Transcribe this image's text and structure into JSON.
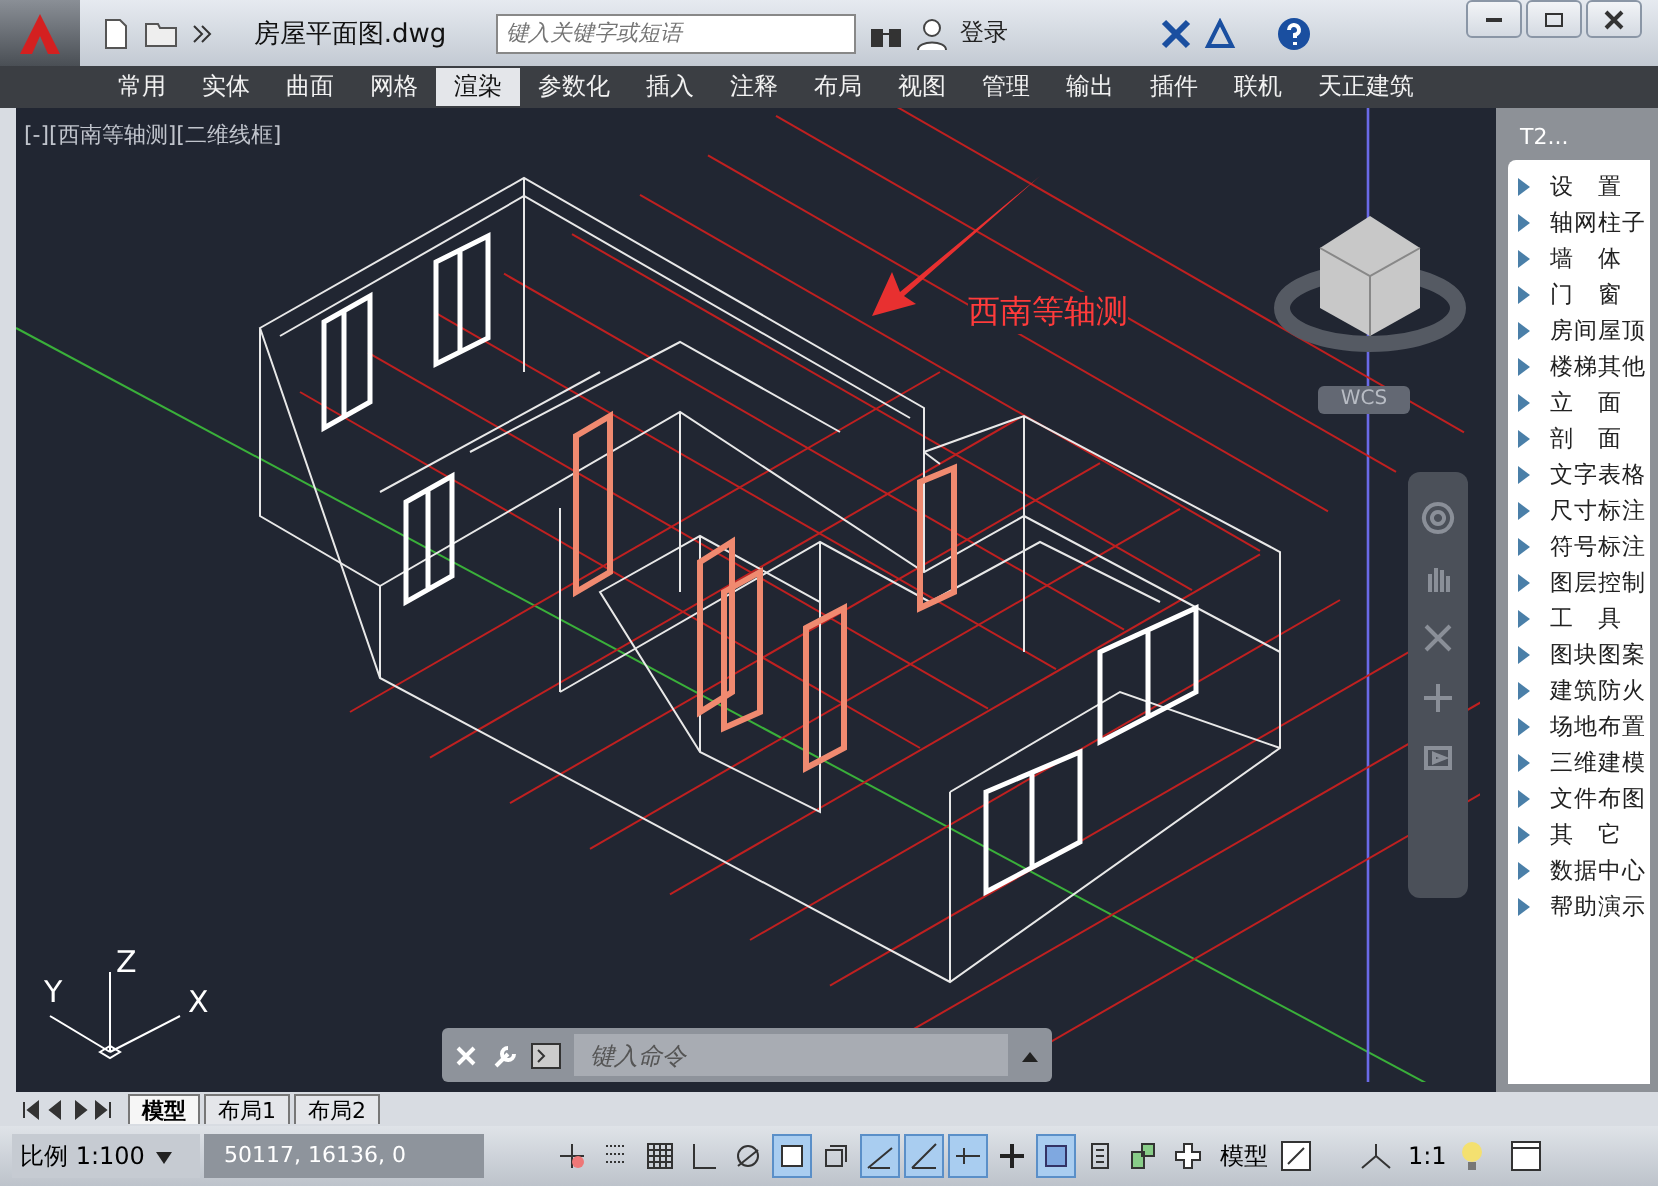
{
  "title_bar": {
    "document_title": "房屋平面图.dwg",
    "search": {
      "placeholder": "键入关键字或短语"
    },
    "login": "登录"
  },
  "ribbon_tabs": [
    {
      "label": "常用",
      "selected": false
    },
    {
      "label": "实体",
      "selected": false
    },
    {
      "label": "曲面",
      "selected": false
    },
    {
      "label": "网格",
      "selected": false
    },
    {
      "label": "渲染",
      "selected": true
    },
    {
      "label": "参数化",
      "selected": false
    },
    {
      "label": "插入",
      "selected": false
    },
    {
      "label": "注释",
      "selected": false
    },
    {
      "label": "布局",
      "selected": false
    },
    {
      "label": "视图",
      "selected": false
    },
    {
      "label": "管理",
      "selected": false
    },
    {
      "label": "输出",
      "selected": false
    },
    {
      "label": "插件",
      "selected": false
    },
    {
      "label": "联机",
      "selected": false
    },
    {
      "label": "天正建筑",
      "selected": false
    }
  ],
  "viewport": {
    "label": "[-][西南等轴测][二维线框]",
    "annotation": "西南等轴测",
    "viewcube": {
      "wcs": "WCS"
    },
    "ucs": {
      "x": "X",
      "y": "Y",
      "z": "Z"
    },
    "command_line": {
      "placeholder": "键入命令"
    }
  },
  "layout_tabs": [
    {
      "label": "模型",
      "selected": true
    },
    {
      "label": "布局1",
      "selected": false
    },
    {
      "label": "布局2",
      "selected": false
    }
  ],
  "status_bar": {
    "scale": "比例 1:100",
    "coordinates": "50117, 16136, 0",
    "toggles": [
      {
        "kind": "infer",
        "on": false
      },
      {
        "kind": "snap",
        "on": false
      },
      {
        "kind": "grid",
        "on": false
      },
      {
        "kind": "ortho",
        "on": false
      },
      {
        "kind": "polar",
        "on": false
      },
      {
        "kind": "osnap",
        "on": true
      },
      {
        "kind": "osnap3d",
        "on": false
      },
      {
        "kind": "otrack",
        "on": true
      },
      {
        "kind": "ducs",
        "on": true
      },
      {
        "kind": "dyn",
        "on": true
      },
      {
        "kind": "lwt",
        "on": false
      },
      {
        "kind": "tpy",
        "on": true
      },
      {
        "kind": "qp",
        "on": false
      },
      {
        "kind": "sc",
        "on": false
      },
      {
        "kind": "am",
        "on": false
      }
    ],
    "model": "模型",
    "annotation_scale": "1:1"
  },
  "side_panel": {
    "title": "T2...",
    "items": [
      "设　置",
      "轴网柱子",
      "墙　体",
      "门　窗",
      "房间屋顶",
      "楼梯其他",
      "立　面",
      "剖　面",
      "文字表格",
      "尺寸标注",
      "符号标注",
      "图层控制",
      "工　具",
      "图块图案",
      "建筑防火",
      "场地布置",
      "三维建模",
      "文件布图",
      "其　它",
      "数据中心",
      "帮助演示"
    ]
  }
}
